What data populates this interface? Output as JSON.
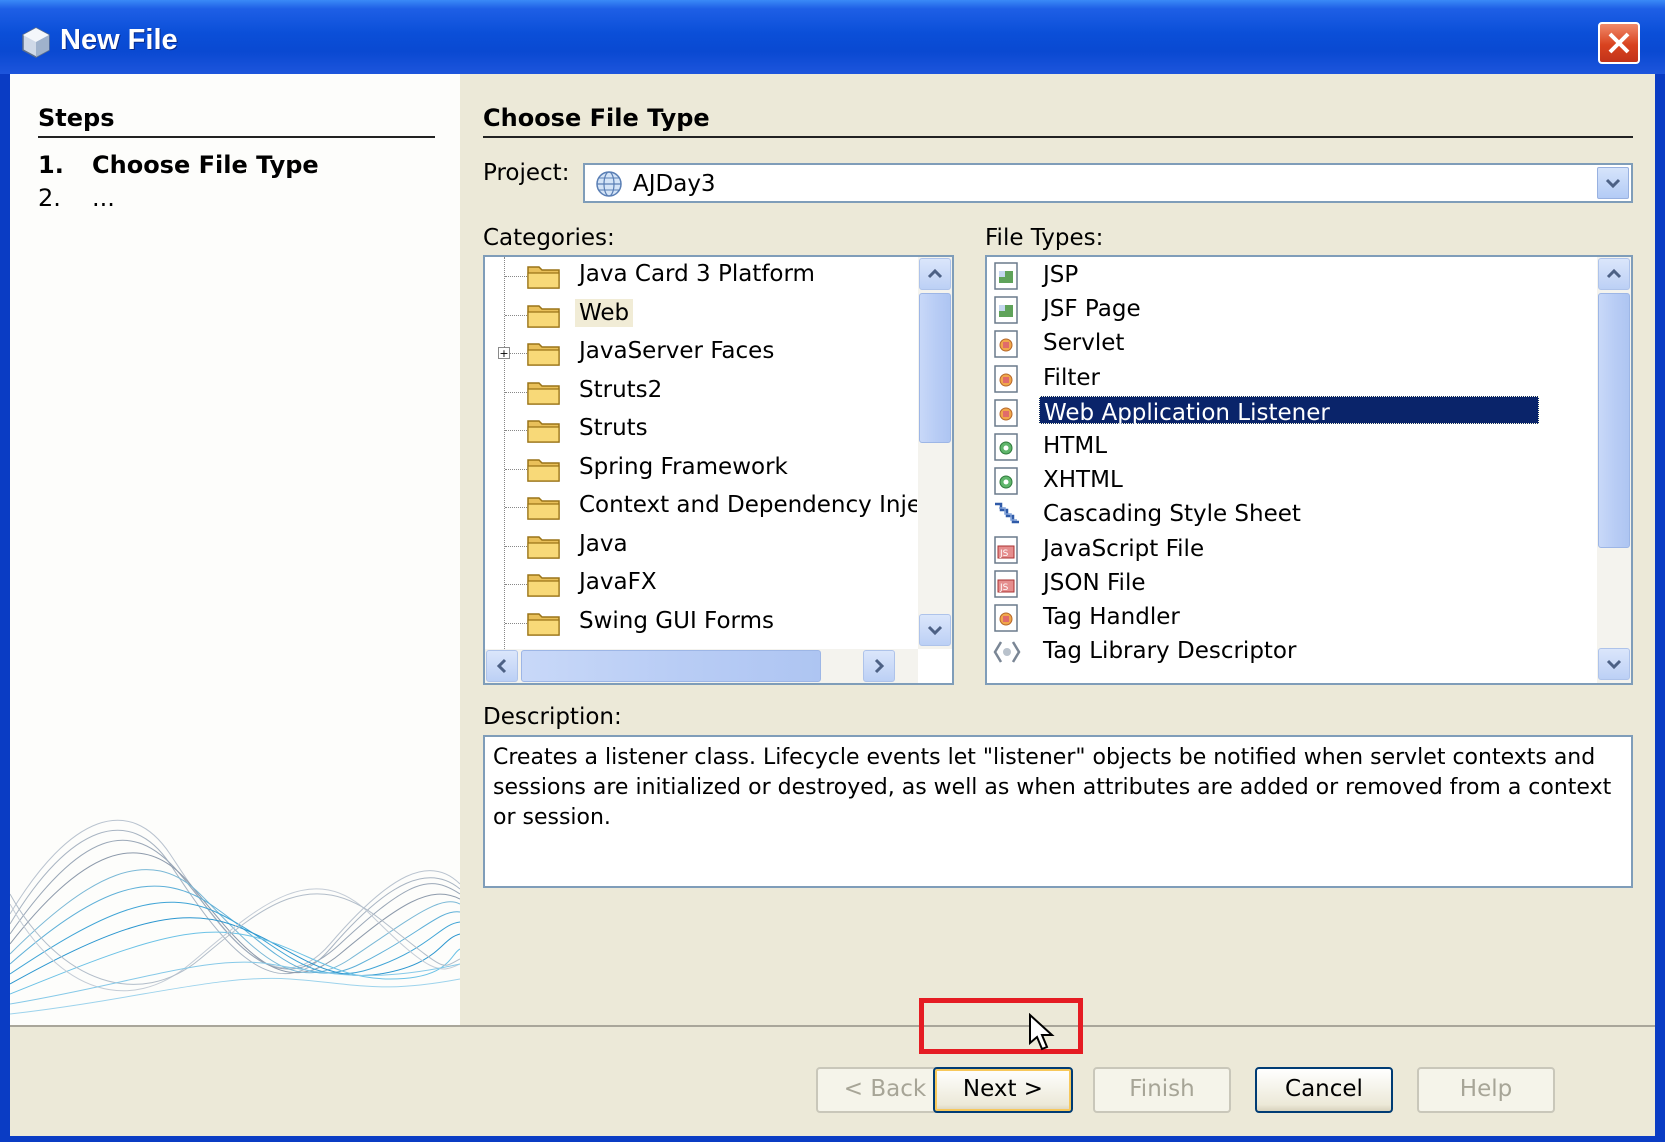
{
  "window": {
    "title": "New File"
  },
  "steps": {
    "heading": "Steps",
    "items": [
      {
        "number": "1.",
        "label": "Choose File Type"
      },
      {
        "number": "2.",
        "label": "..."
      }
    ]
  },
  "main": {
    "heading": "Choose File Type",
    "project_label": "Project:",
    "project_value": "AJDay3",
    "categories_label": "Categories:",
    "file_types_label": "File Types:",
    "description_label": "Description:",
    "description": "Creates a listener class. Lifecycle events let \"listener\" objects be notified when servlet contexts and sessions are initialized or destroyed, as well as when attributes are added or removed from a context or session."
  },
  "categories": [
    {
      "label": "Java Card 3 Platform",
      "selected": false,
      "expandable": false
    },
    {
      "label": "Web",
      "selected": true,
      "expandable": false
    },
    {
      "label": "JavaServer Faces",
      "selected": false,
      "expandable": true
    },
    {
      "label": "Struts2",
      "selected": false,
      "expandable": false
    },
    {
      "label": "Struts",
      "selected": false,
      "expandable": false
    },
    {
      "label": "Spring Framework",
      "selected": false,
      "expandable": false
    },
    {
      "label": "Context and Dependency Inje",
      "selected": false,
      "expandable": false
    },
    {
      "label": "Java",
      "selected": false,
      "expandable": false
    },
    {
      "label": "JavaFX",
      "selected": false,
      "expandable": false
    },
    {
      "label": "Swing GUI Forms",
      "selected": false,
      "expandable": false
    }
  ],
  "file_types": [
    {
      "label": "JSP",
      "icon": "jsp-file-icon",
      "selected": false
    },
    {
      "label": "JSF Page",
      "icon": "jsp-file-icon",
      "selected": false
    },
    {
      "label": "Servlet",
      "icon": "java-class-file-icon",
      "selected": false
    },
    {
      "label": "Filter",
      "icon": "java-class-file-icon",
      "selected": false
    },
    {
      "label": "Web Application Listener",
      "icon": "java-class-file-icon",
      "selected": true
    },
    {
      "label": "HTML",
      "icon": "html-file-icon",
      "selected": false
    },
    {
      "label": "XHTML",
      "icon": "html-file-icon",
      "selected": false
    },
    {
      "label": "Cascading Style Sheet",
      "icon": "css-file-icon",
      "selected": false
    },
    {
      "label": "JavaScript File",
      "icon": "js-file-icon",
      "selected": false
    },
    {
      "label": "JSON File",
      "icon": "js-file-icon",
      "selected": false
    },
    {
      "label": "Tag Handler",
      "icon": "java-class-file-icon",
      "selected": false
    },
    {
      "label": "Tag Library Descriptor",
      "icon": "tld-file-icon",
      "selected": false
    }
  ],
  "buttons": {
    "back": "< Back",
    "next": "Next >",
    "finish": "Finish",
    "cancel": "Cancel",
    "help": "Help"
  },
  "colors": {
    "title_bar": "#0a49d2",
    "selection": "#0a246a",
    "highlight_box": "#e51c23",
    "dialog_bg": "#ece9d8"
  }
}
